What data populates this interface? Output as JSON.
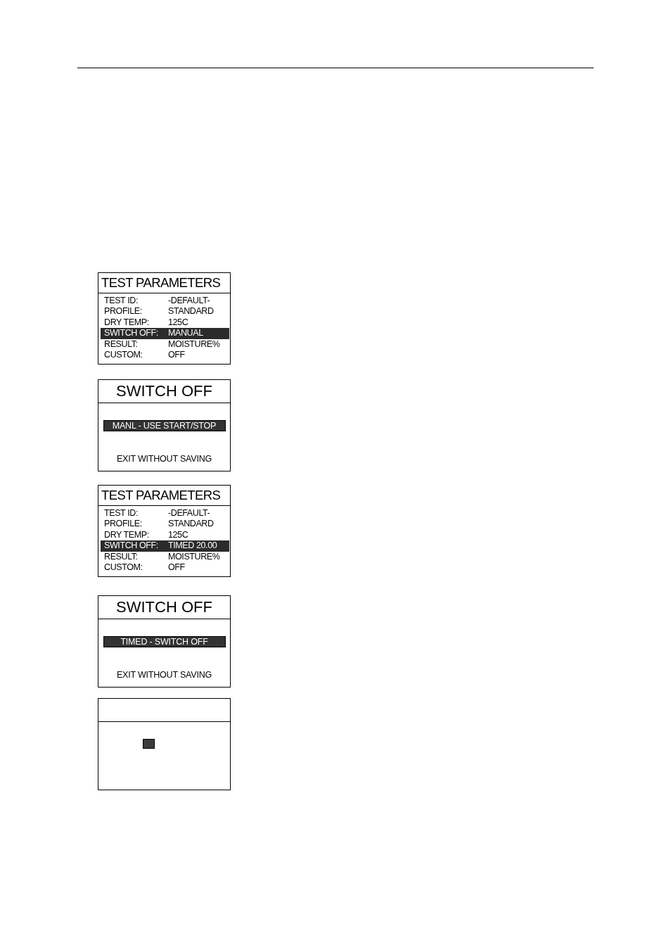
{
  "screens": [
    {
      "kind": "parameters",
      "title": "TEST PARAMETERS",
      "rows": [
        {
          "label": "TEST ID:",
          "value": "-DEFAULT-",
          "selected": false
        },
        {
          "label": "PROFILE:",
          "value": "STANDARD",
          "selected": false
        },
        {
          "label": "DRY TEMP:",
          "value": "125C",
          "selected": false
        },
        {
          "label": "SWITCH OFF:",
          "value": "MANUAL",
          "selected": true
        },
        {
          "label": "RESULT:",
          "value": "MOISTURE%",
          "selected": false
        },
        {
          "label": "CUSTOM:",
          "value": "OFF",
          "selected": false
        }
      ]
    },
    {
      "kind": "menu",
      "title": "SWITCH OFF",
      "options": [
        {
          "label": "MANL - USE START/STOP",
          "selected": true
        },
        {
          "label": "EXIT WITHOUT SAVING",
          "selected": false
        }
      ]
    },
    {
      "kind": "parameters",
      "title": "TEST PARAMETERS",
      "rows": [
        {
          "label": "TEST ID:",
          "value": "-DEFAULT-",
          "selected": false
        },
        {
          "label": "PROFILE:",
          "value": "STANDARD",
          "selected": false
        },
        {
          "label": "DRY TEMP:",
          "value": "125C",
          "selected": false
        },
        {
          "label": "SWITCH OFF:",
          "value": "TIMED 20.00",
          "selected": true
        },
        {
          "label": "RESULT:",
          "value": "MOISTURE%",
          "selected": false
        },
        {
          "label": "CUSTOM:",
          "value": "OFF",
          "selected": false
        }
      ]
    },
    {
      "kind": "menu",
      "title": "SWITCH OFF",
      "options": [
        {
          "label": "TIMED - SWITCH OFF",
          "selected": true
        },
        {
          "label": "EXIT WITHOUT SAVING",
          "selected": false
        }
      ]
    },
    {
      "kind": "blank"
    }
  ]
}
